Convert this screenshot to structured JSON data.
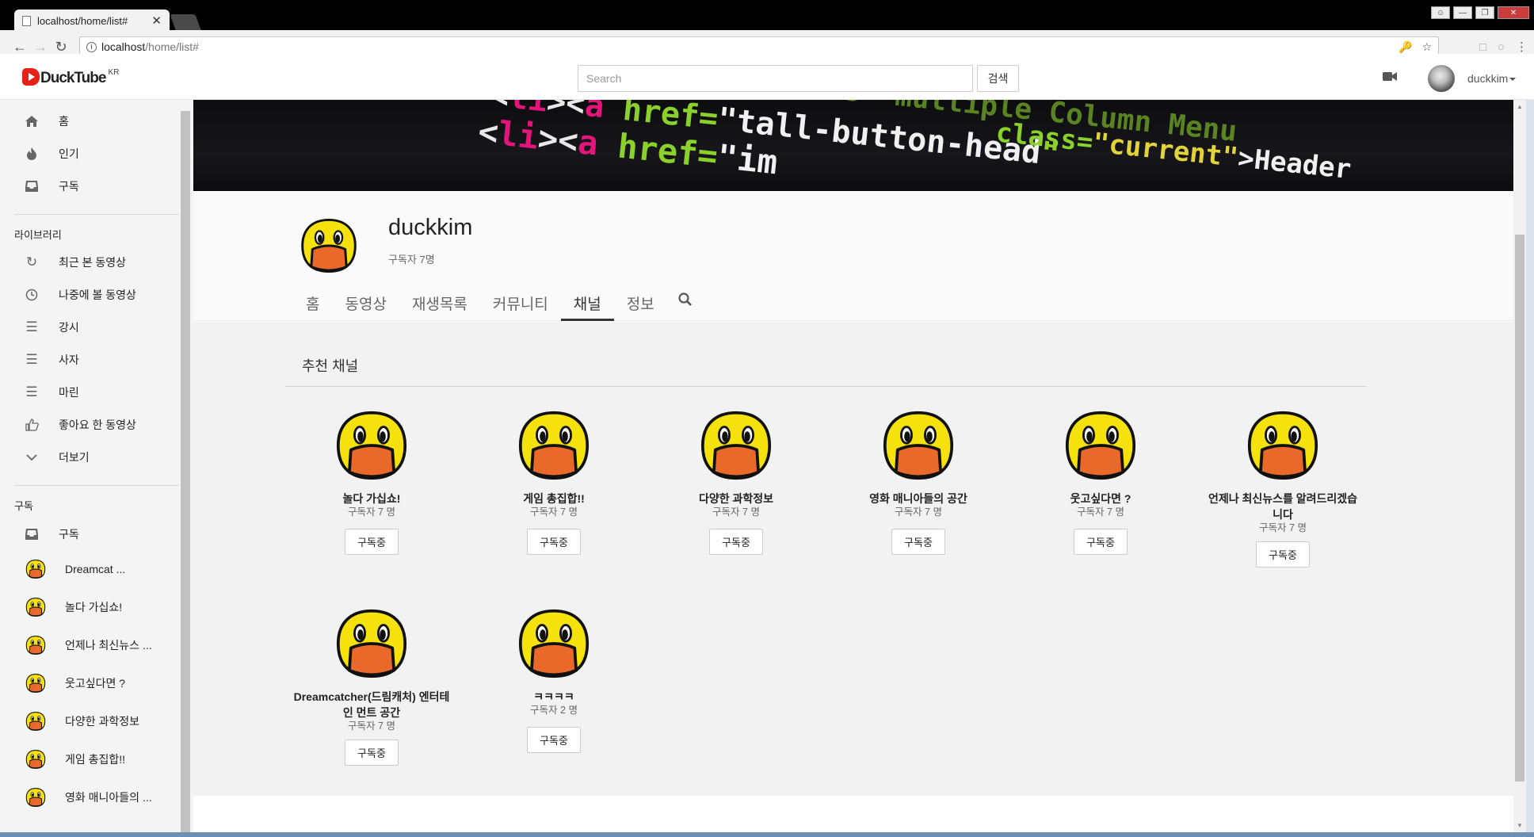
{
  "browser": {
    "tab_title": "localhost/home/list#",
    "tab_close": "✕",
    "url_host": "localhost",
    "url_path": "/home/list#"
  },
  "app": {
    "logo_text": "DuckTube",
    "logo_sup": "KR",
    "search_placeholder": "Search",
    "search_button": "검색",
    "username": "duckkim"
  },
  "sidebar": {
    "main_items": [
      {
        "label": "홈",
        "icon": "home-icon"
      },
      {
        "label": "인기",
        "icon": "fire-icon"
      },
      {
        "label": "구독",
        "icon": "inbox-icon"
      }
    ],
    "library_heading": "라이브러리",
    "library_items": [
      {
        "label": "최근 본 동영상",
        "icon": "history-icon"
      },
      {
        "label": "나중에 볼 동영상",
        "icon": "clock-icon"
      },
      {
        "label": "강시",
        "icon": "list-icon"
      },
      {
        "label": "사자",
        "icon": "list-icon"
      },
      {
        "label": "마린",
        "icon": "list-icon"
      },
      {
        "label": "좋아요 한 동영상",
        "icon": "thumbs-up-icon"
      },
      {
        "label": "더보기",
        "icon": "chevron-down-icon"
      }
    ],
    "subs_heading": "구독",
    "subs_all": "구독",
    "subscriptions": [
      "Dreamcat ...",
      "놀다 가십쇼!",
      "언제나 최신뉴스 ...",
      "웃고싶다면 ?",
      "다양한 과학정보",
      "게임 총집합!!",
      "영화 매니아들의 ..."
    ]
  },
  "channel": {
    "name": "duckkim",
    "subscribers": "구독자 7명",
    "tabs": [
      "홈",
      "동영상",
      "재생목록",
      "커뮤니티",
      "채널",
      "정보"
    ],
    "active_tab": "채널"
  },
  "recommended": {
    "title": "추천 채널",
    "button_label": "구독중",
    "channels": [
      {
        "name": "놀다 가십쇼!",
        "subs": "구독자 7 명"
      },
      {
        "name": "게임 총집합!!",
        "subs": "구독자 7 명"
      },
      {
        "name": "다양한 과학정보",
        "subs": "구독자 7 명"
      },
      {
        "name": "영화 매니아들의 공간",
        "subs": "구독자 7 명"
      },
      {
        "name": "웃고싶다면 ?",
        "subs": "구독자 7 명"
      },
      {
        "name": "언제나 최신뉴스를 알려드리겠습니다",
        "subs": "구독자 7 명"
      },
      {
        "name": "Dreamcatcher(드림캐처) 엔터테인 먼트 공간",
        "subs": "구독자 7 명"
      },
      {
        "name": "ㅋㅋㅋㅋ",
        "subs": "구독자 2 명"
      }
    ]
  },
  "colors": {
    "duck_yellow": "#f5e20d",
    "duck_beak": "#e8692a",
    "logo_red": "#e62117",
    "active_tab_underline": "#333333"
  }
}
